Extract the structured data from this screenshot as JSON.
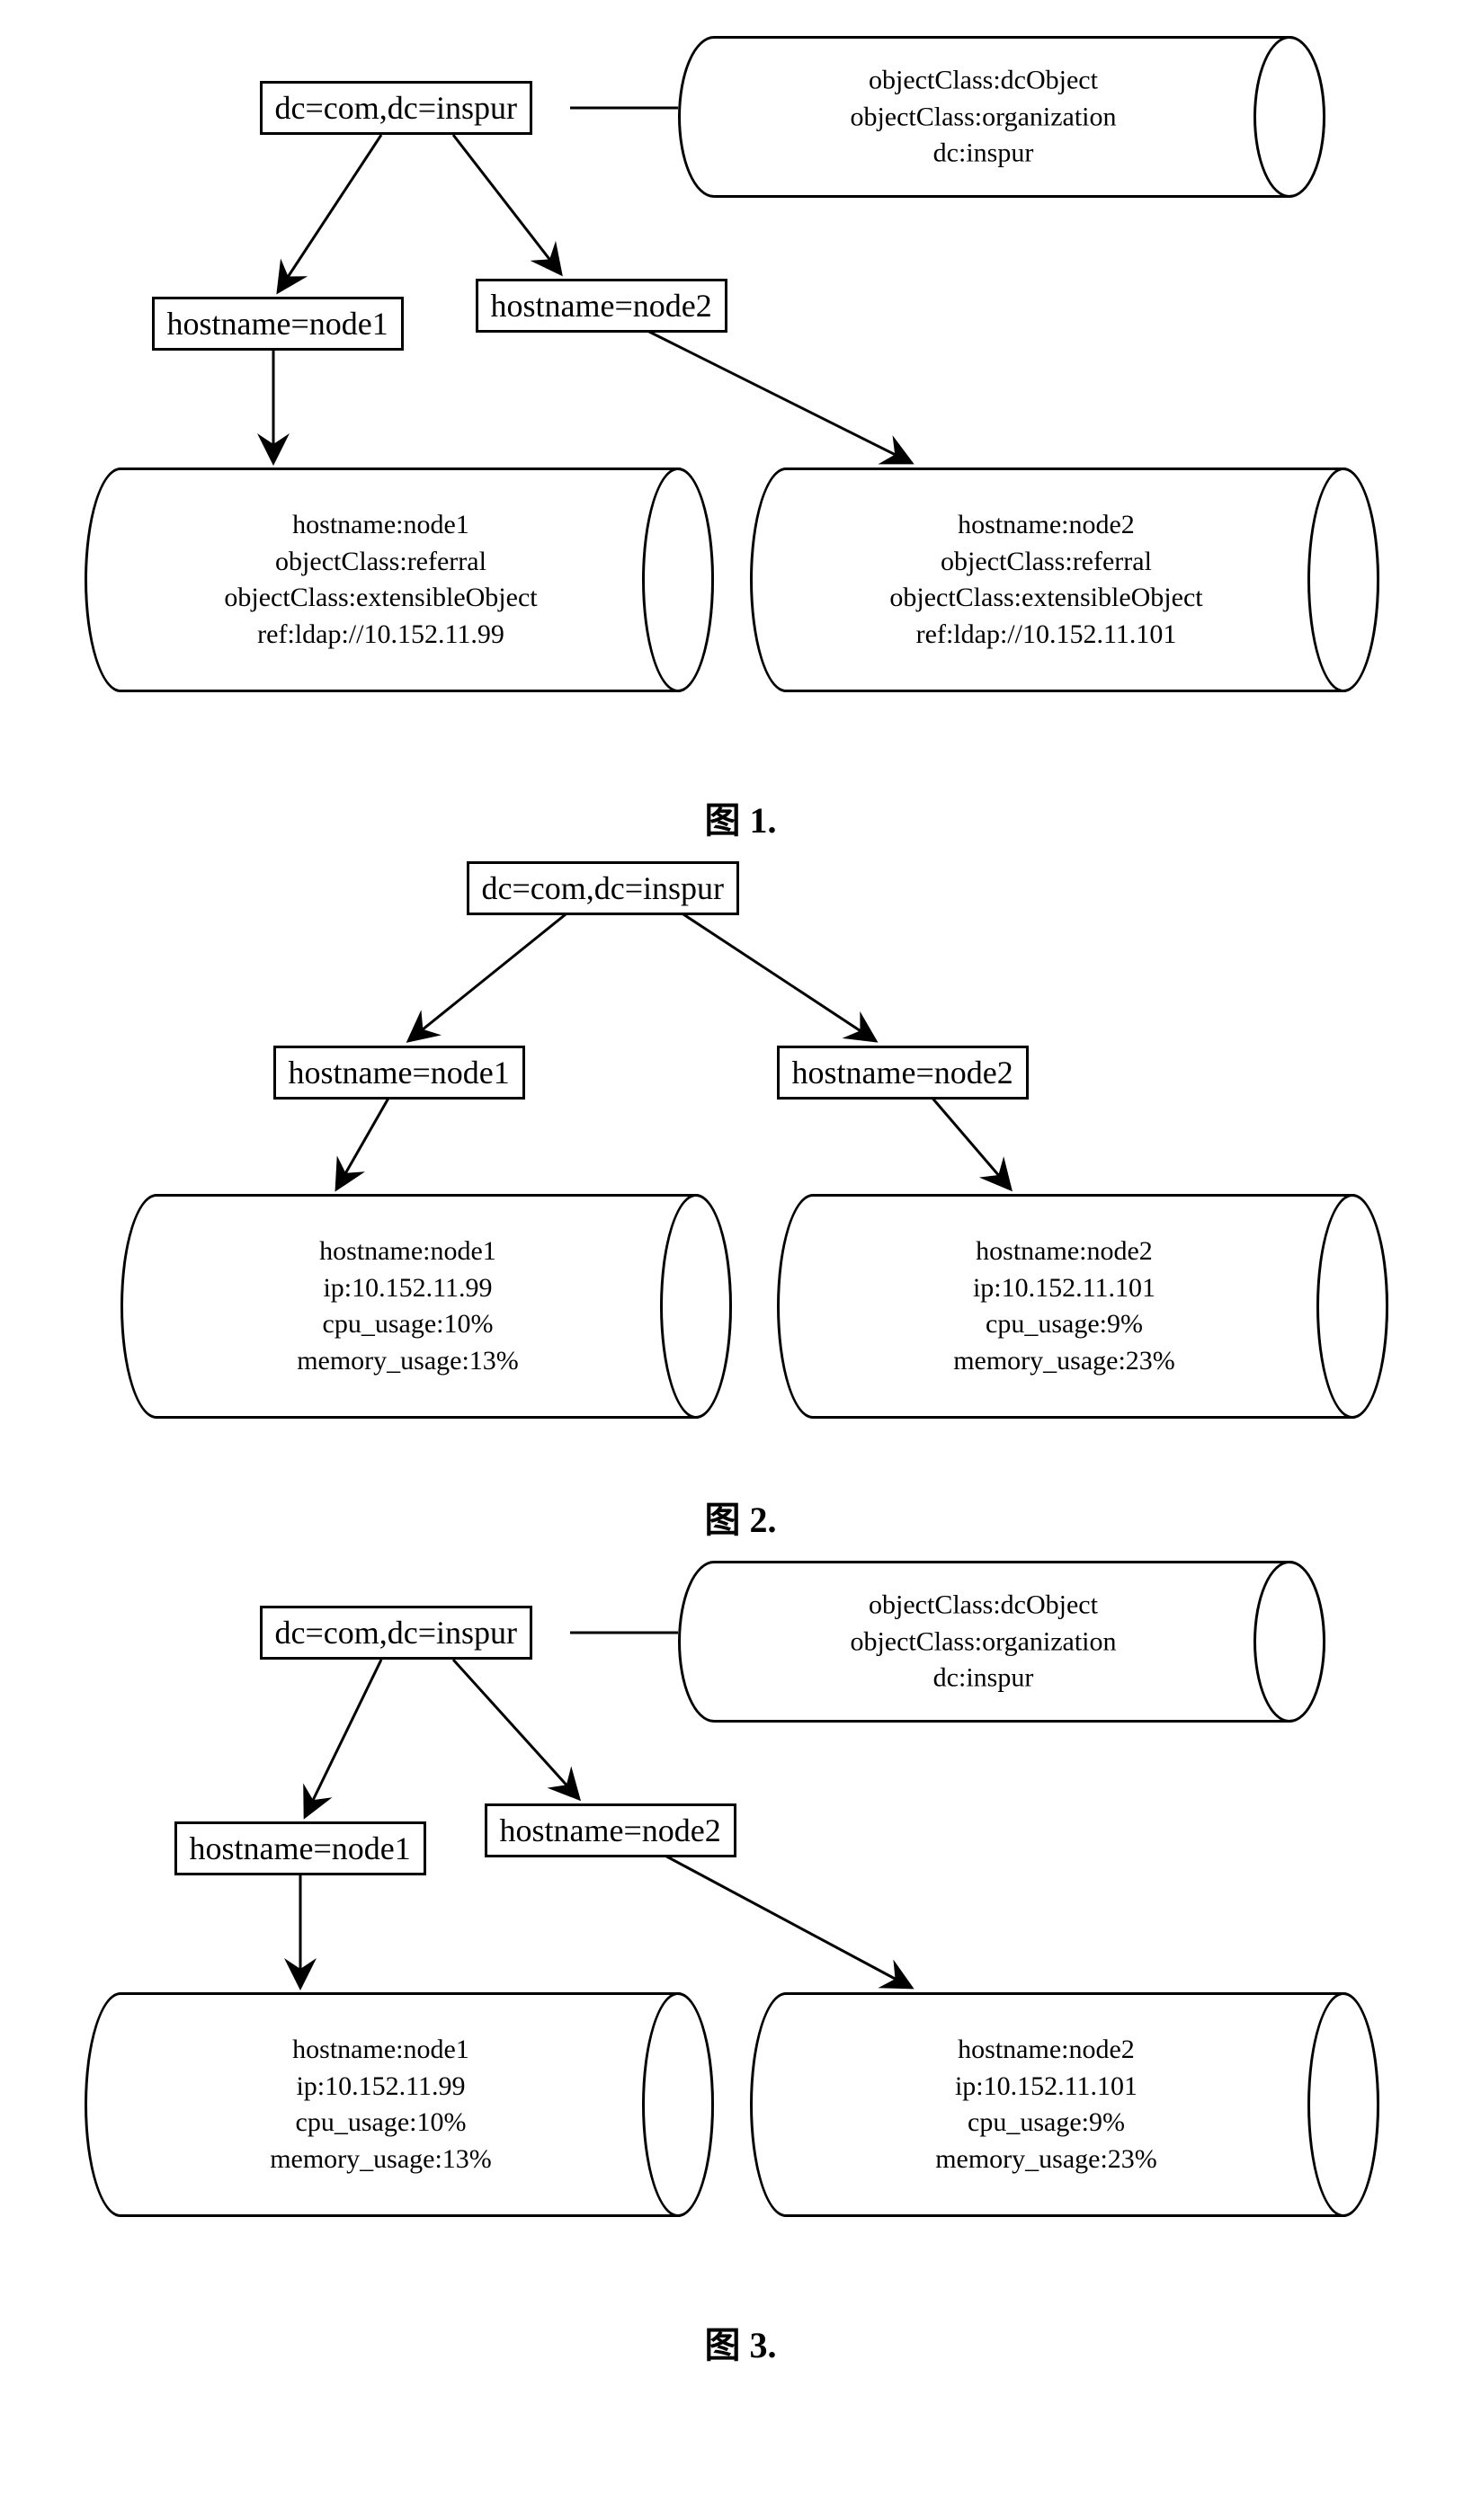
{
  "fig1": {
    "caption": "图 1.",
    "root": "dc=com,dc=inspur",
    "rootCyl": [
      "objectClass:dcObject",
      "objectClass:organization",
      "dc:inspur"
    ],
    "node1": "hostname=node1",
    "node2": "hostname=node2",
    "cyl1": [
      "hostname:node1",
      "objectClass:referral",
      "objectClass:extensibleObject",
      "ref:ldap://10.152.11.99"
    ],
    "cyl2": [
      "hostname:node2",
      "objectClass:referral",
      "objectClass:extensibleObject",
      "ref:ldap://10.152.11.101"
    ]
  },
  "fig2": {
    "caption": "图 2.",
    "root": "dc=com,dc=inspur",
    "node1": "hostname=node1",
    "node2": "hostname=node2",
    "cyl1": [
      "hostname:node1",
      "ip:10.152.11.99",
      "cpu_usage:10%",
      "memory_usage:13%"
    ],
    "cyl2": [
      "hostname:node2",
      "ip:10.152.11.101",
      "cpu_usage:9%",
      "memory_usage:23%"
    ]
  },
  "fig3": {
    "caption": "图 3.",
    "root": "dc=com,dc=inspur",
    "rootCyl": [
      "objectClass:dcObject",
      "objectClass:organization",
      "dc:inspur"
    ],
    "node1": "hostname=node1",
    "node2": "hostname=node2",
    "cyl1": [
      "hostname:node1",
      "ip:10.152.11.99",
      "cpu_usage:10%",
      "memory_usage:13%"
    ],
    "cyl2": [
      "hostname:node2",
      "ip:10.152.11.101",
      "cpu_usage:9%",
      "memory_usage:23%"
    ]
  }
}
